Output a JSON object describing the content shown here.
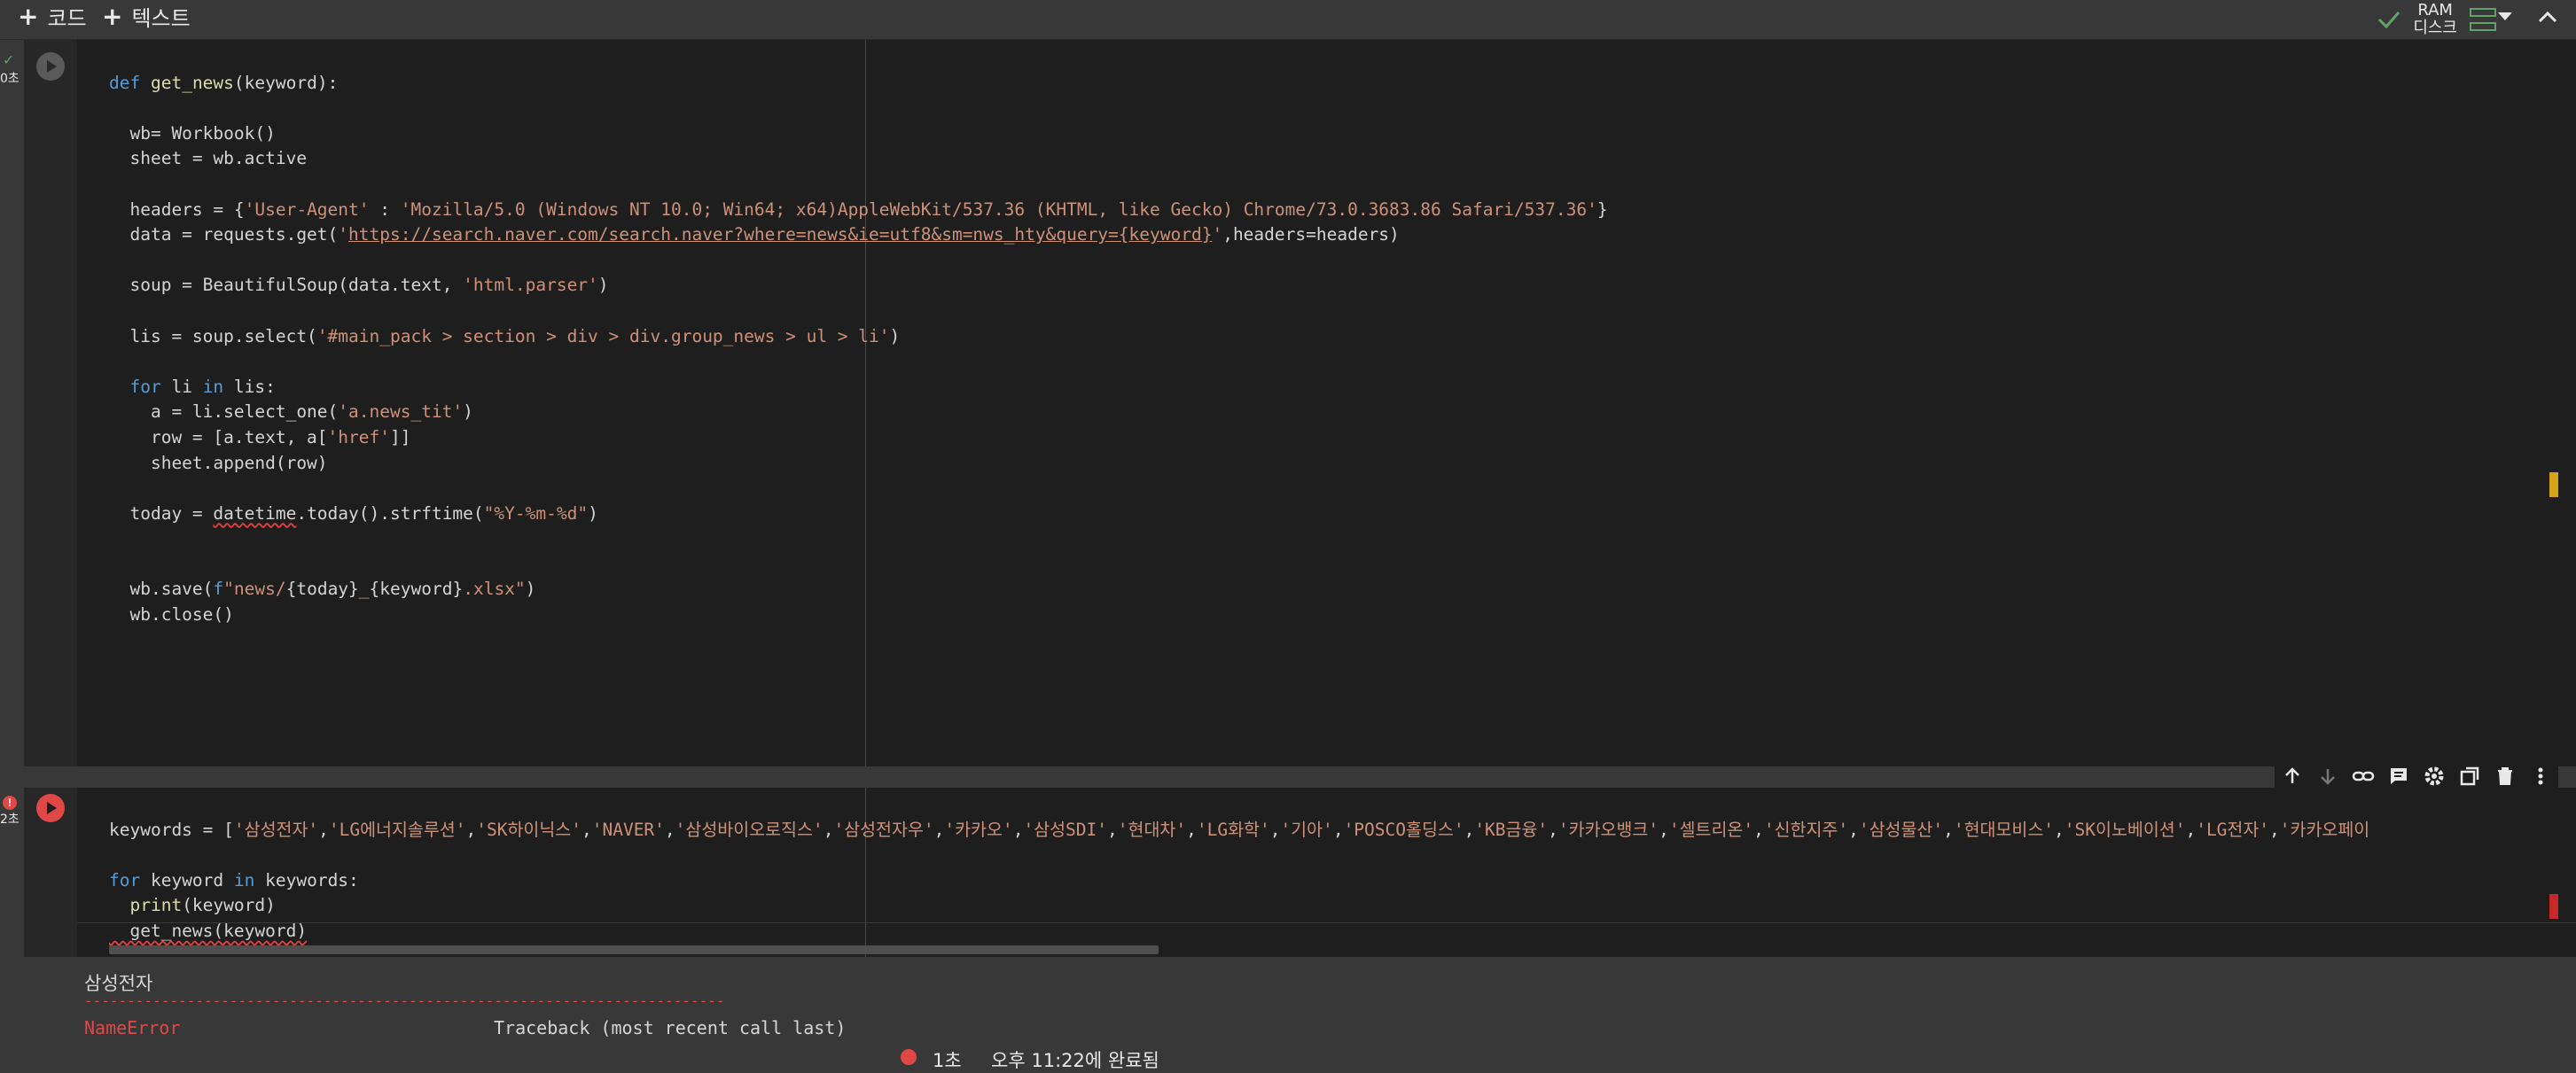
{
  "toolbar": {
    "add_code_label": "코드",
    "add_text_label": "텍스트",
    "ram_label": "RAM",
    "disk_label": "디스크"
  },
  "cell1": {
    "exec_mark": "✓",
    "exec_time": "0초",
    "lines": [
      "def get_news(keyword):",
      "",
      "  wb= Workbook()",
      "  sheet = wb.active",
      "",
      "  headers = {'User-Agent' : 'Mozilla/5.0 (Windows NT 10.0; Win64; x64)AppleWebKit/537.36 (KHTML, like Gecko) Chrome/73.0.3683.86 Safari/537.36'}",
      "  data = requests.get('https://search.naver.com/search.naver?where=news&ie=utf8&sm=nws_hty&query={keyword}',headers=headers)",
      "",
      "  soup = BeautifulSoup(data.text, 'html.parser')",
      "",
      "  lis = soup.select('#main_pack > section > div > div.group_news > ul > li')",
      "",
      "  for li in lis:",
      "    a = li.select_one('a.news_tit')",
      "    row = [a.text, a['href']]",
      "    sheet.append(row)",
      "",
      "  today = datetime.today().strftime(\"%Y-%m-%d\")",
      "",
      "",
      "  wb.save(f\"news/{today}_{keyword}.xlsx\")",
      "  wb.close()"
    ]
  },
  "cell2": {
    "exec_mark": "!",
    "exec_time": "2초",
    "lines": [
      "keywords = ['삼성전자','LG에너지솔루션','SK하이닉스','NAVER','삼성바이오로직스','삼성전자우','카카오','삼성SDI','현대차','LG화학','기아','POSCO홀딩스','KB금융','카카오뱅크','셀트리온','신한지주','삼성물산','현대모비스','SK이노베이션','LG전자','카카오페이",
      "",
      "for keyword in keywords:",
      "  print(keyword)",
      "  get_news(keyword)"
    ]
  },
  "output": {
    "first_line": "삼성전자",
    "dashes": "---------------------------------------------------------------------------",
    "error_name": "NameError",
    "traceback_label": "Traceback (most recent call last)"
  },
  "status": {
    "text": "1초     오후 11:22에 완료됨"
  },
  "colors": {
    "success": "#5fa36b",
    "error": "#e04848",
    "keyword": "#569cd6",
    "string": "#ce9178"
  }
}
